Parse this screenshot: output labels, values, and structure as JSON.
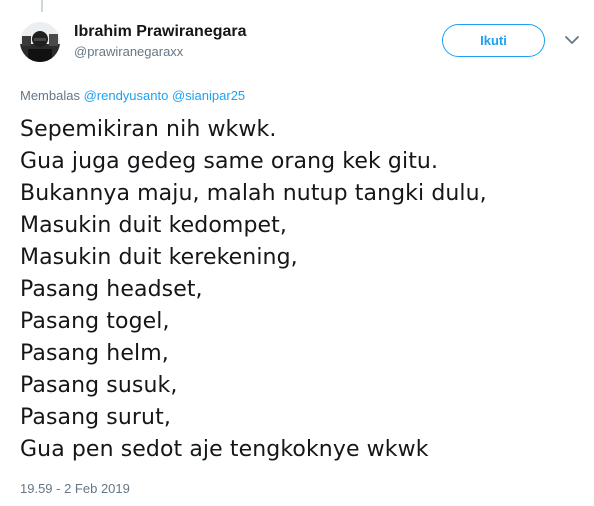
{
  "tweet": {
    "author": {
      "display_name": "Ibrahim Prawiranegara",
      "screen_name": "@prawiranegaraxx",
      "avatar_icon": "user-avatar-photo"
    },
    "follow_label": "Ikuti",
    "menu_icon": "chevron-down-icon",
    "reply_context": {
      "prefix": "Membalas",
      "mentions": [
        "@rendyusanto",
        "@sianipar25"
      ]
    },
    "text_lines": [
      "Sepemikiran nih wkwk.",
      "Gua juga gedeg same orang kek gitu.",
      "Bukannya maju, malah nutup tangki dulu,",
      "Masukin duit kedompet,",
      "Masukin duit kerekening,",
      "Pasang headset,",
      "Pasang togel,",
      "Pasang helm,",
      "Pasang susuk,",
      "Pasang surut,",
      "Gua pen sedot aje tengkoknye wkwk"
    ],
    "timestamp": "19.59 - 2 Feb 2019"
  },
  "colors": {
    "accent": "#1da1f2",
    "text_primary": "#14171a",
    "text_secondary": "#657786",
    "thread_line": "#ccd6dd"
  }
}
